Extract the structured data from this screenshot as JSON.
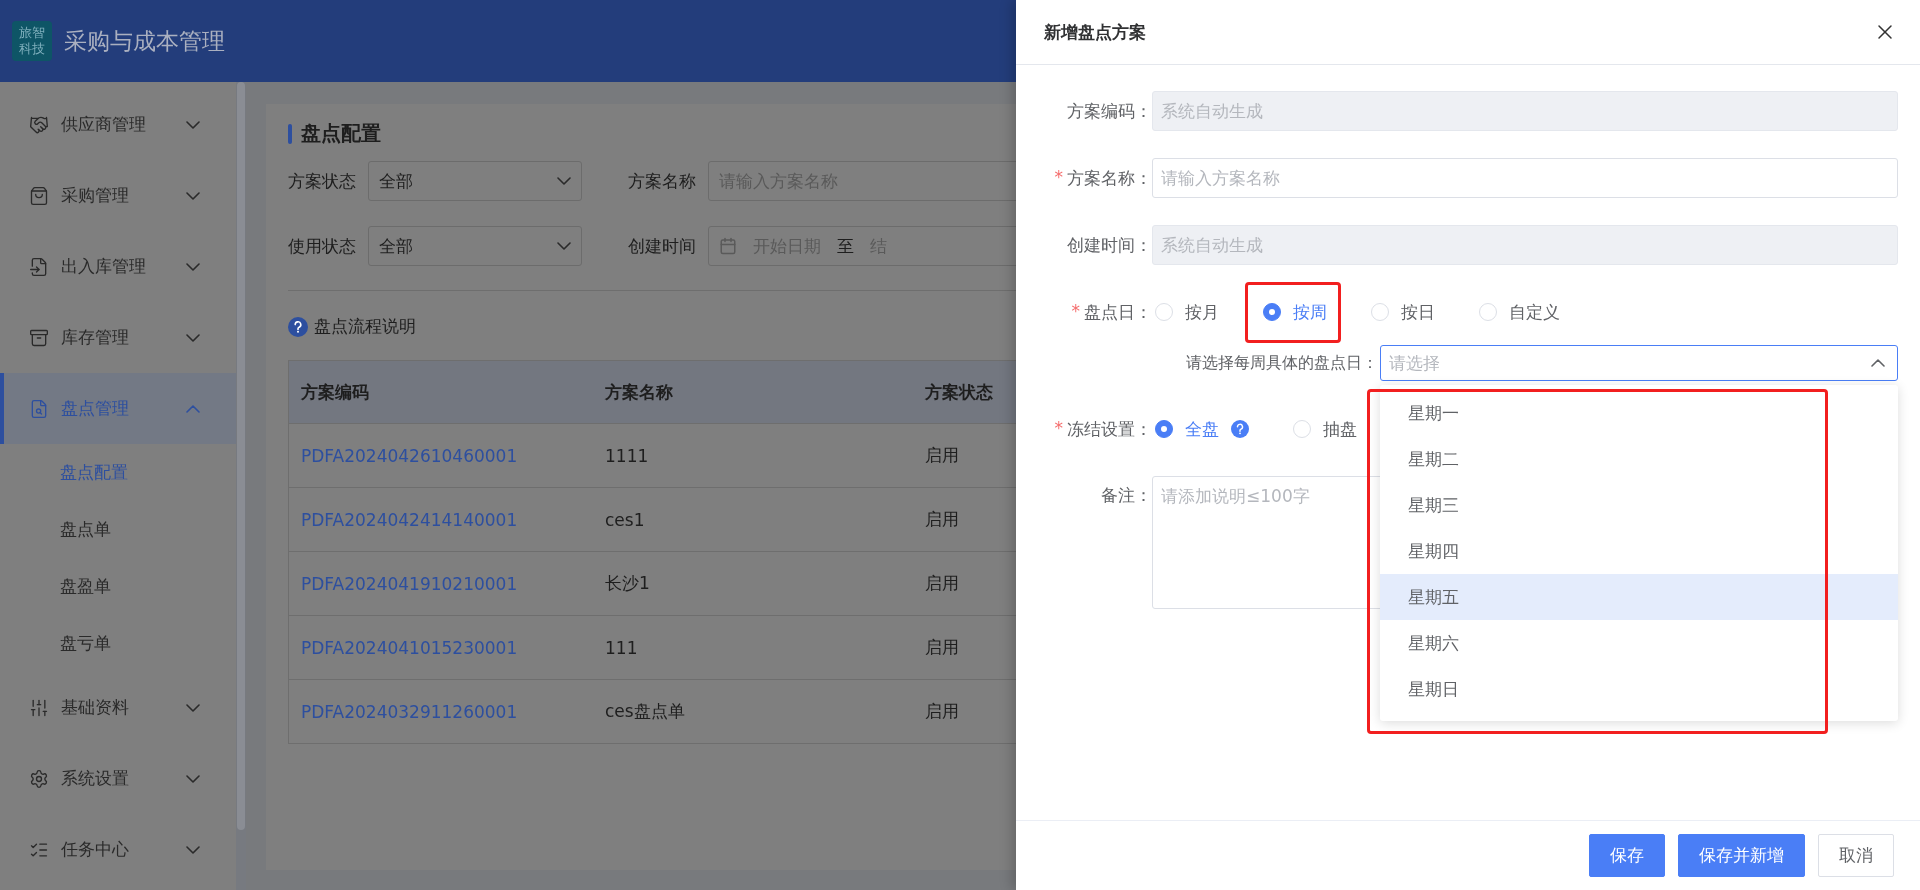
{
  "header": {
    "logo_lines": [
      "旅智",
      "科技"
    ],
    "title": "采购与成本管理"
  },
  "sidebar": {
    "items": [
      {
        "label": "供应商管理",
        "selected": false,
        "expanded": false
      },
      {
        "label": "采购管理",
        "selected": false,
        "expanded": false
      },
      {
        "label": "出入库管理",
        "selected": false,
        "expanded": false
      },
      {
        "label": "库存管理",
        "selected": false,
        "expanded": false
      },
      {
        "label": "盘点管理",
        "selected": true,
        "expanded": true,
        "children": [
          {
            "label": "盘点配置",
            "selected": true
          },
          {
            "label": "盘点单",
            "selected": false
          },
          {
            "label": "盘盈单",
            "selected": false
          },
          {
            "label": "盘亏单",
            "selected": false
          }
        ]
      },
      {
        "label": "基础资料",
        "selected": false,
        "expanded": false
      },
      {
        "label": "系统设置",
        "selected": false,
        "expanded": false
      },
      {
        "label": "任务中心",
        "selected": false,
        "expanded": false
      }
    ]
  },
  "page": {
    "title": "盘点配置",
    "filters": [
      {
        "kind": "select",
        "label": "方案状态",
        "value": "全部"
      },
      {
        "kind": "input",
        "label": "方案名称",
        "placeholder": "请输入方案名称"
      },
      {
        "kind": "select",
        "label": "使用状态",
        "value": "全部"
      },
      {
        "kind": "daterange",
        "label": "创建时间",
        "start_placeholder": "开始日期",
        "separator": "至",
        "end_placeholder": "结"
      }
    ],
    "help_link": "盘点流程说明",
    "table": {
      "columns": [
        "方案编码",
        "方案名称",
        "方案状态"
      ],
      "rows": [
        [
          "PDFA2024042610460001",
          "1111",
          "启用"
        ],
        [
          "PDFA2024042414140001",
          "ces1",
          "启用"
        ],
        [
          "PDFA2024041910210001",
          "长沙1",
          "启用"
        ],
        [
          "PDFA2024041015230001",
          "111",
          "启用"
        ],
        [
          "PDFA2024032911260001",
          "ces盘点单",
          "启用"
        ]
      ]
    }
  },
  "drawer": {
    "title": "新增盘点方案",
    "fields": [
      {
        "kind": "input",
        "label": "方案编码：",
        "placeholder": "系统自动生成",
        "disabled": true
      },
      {
        "kind": "input",
        "label": "方案名称：",
        "required_mark": "*",
        "placeholder": "请输入方案名称",
        "disabled": false
      },
      {
        "kind": "input",
        "label": "创建时间：",
        "placeholder": "系统自动生成",
        "disabled": true
      },
      {
        "kind": "radio",
        "label": "盘点日：",
        "required_mark": "*",
        "options": [
          {
            "label": "按月",
            "selected": false,
            "highlighted": false,
            "help": false
          },
          {
            "label": "按周",
            "selected": true,
            "highlighted": true,
            "help": false
          },
          {
            "label": "按日",
            "selected": false,
            "highlighted": false,
            "help": false
          },
          {
            "label": "自定义",
            "selected": false,
            "highlighted": false,
            "help": false
          }
        ],
        "sub_select": {
          "label": "请选择每周具体的盘点日：",
          "placeholder": "请选择",
          "open": true,
          "highlighted": true,
          "options": [
            {
              "label": "星期一",
              "hovered": false
            },
            {
              "label": "星期二",
              "hovered": false
            },
            {
              "label": "星期三",
              "hovered": false
            },
            {
              "label": "星期四",
              "hovered": false
            },
            {
              "label": "星期五",
              "hovered": true
            },
            {
              "label": "星期六",
              "hovered": false
            },
            {
              "label": "星期日",
              "hovered": false
            }
          ]
        }
      },
      {
        "kind": "radio",
        "label": "冻结设置：",
        "required_mark": "*",
        "options": [
          {
            "label": "全盘",
            "selected": true,
            "highlighted": false,
            "help": true
          },
          {
            "label": "抽盘",
            "selected": false,
            "highlighted": false,
            "help": false
          }
        ]
      },
      {
        "kind": "textarea",
        "label": "备注：",
        "placeholder": "请添加说明≤100字"
      }
    ],
    "buttons": [
      {
        "label": "保存",
        "kind": "primary"
      },
      {
        "label": "保存并新增",
        "kind": "primary"
      },
      {
        "label": "取消",
        "kind": "default"
      }
    ]
  }
}
